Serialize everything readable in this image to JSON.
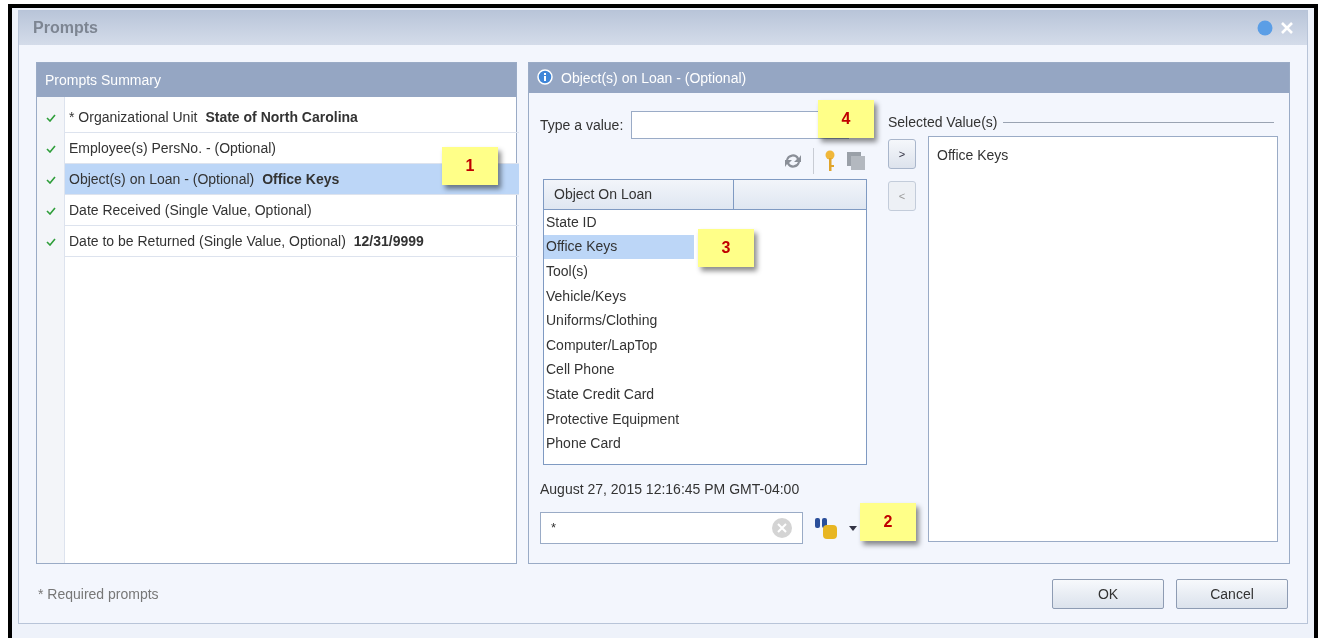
{
  "window": {
    "title": "Prompts"
  },
  "summary": {
    "title": "Prompts Summary",
    "items": [
      {
        "label": "* Organizational Unit",
        "value": "State of North Carolina",
        "checked": true,
        "selected": false
      },
      {
        "label": "Employee(s) PersNo. -  (Optional)",
        "checked": true,
        "selected": false
      },
      {
        "label": "Object(s) on Loan - (Optional)",
        "value": "Office Keys",
        "checked": true,
        "selected": true
      },
      {
        "label": "Date Received (Single Value, Optional)",
        "checked": true,
        "selected": false
      },
      {
        "label": "Date to be Returned (Single Value, Optional)",
        "value": "12/31/9999",
        "checked": true,
        "selected": false
      }
    ]
  },
  "prompt": {
    "title": "Object(s) on Loan - (Optional)",
    "type_label": "Type a value:",
    "table": {
      "columns": [
        "Object On Loan"
      ],
      "rows": [
        {
          "text": "State ID",
          "selected": false
        },
        {
          "text": "Office Keys",
          "selected": true
        },
        {
          "text": "Tool(s)",
          "selected": false
        },
        {
          "text": "Vehicle/Keys",
          "selected": false
        },
        {
          "text": "Uniforms/Clothing",
          "selected": false
        },
        {
          "text": "Computer/LapTop",
          "selected": false
        },
        {
          "text": "Cell Phone",
          "selected": false
        },
        {
          "text": "State Credit Card",
          "selected": false
        },
        {
          "text": "Protective Equipment",
          "selected": false
        },
        {
          "text": "Phone Card",
          "selected": false
        }
      ]
    },
    "timestamp": "August 27, 2015 12:16:45 PM GMT-04:00",
    "search_value": "*",
    "add_button": ">",
    "remove_button": "<",
    "selected_title": "Selected Value(s)",
    "selected_values": [
      "Office Keys"
    ]
  },
  "callouts": [
    "1",
    "2",
    "3",
    "4"
  ],
  "footer": {
    "note": "* Required prompts",
    "buttons": [
      "OK",
      "Cancel"
    ]
  }
}
